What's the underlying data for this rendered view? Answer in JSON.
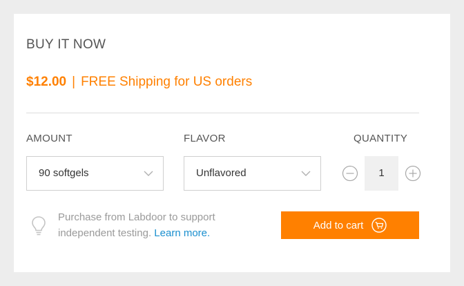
{
  "widget": {
    "title": "BUY IT NOW",
    "price": "$12.00",
    "separator": "|",
    "shipping": "FREE Shipping for US orders"
  },
  "options": {
    "amount": {
      "label": "AMOUNT",
      "value": "90 softgels"
    },
    "flavor": {
      "label": "FLAVOR",
      "value": "Unflavored"
    },
    "quantity": {
      "label": "QUANTITY",
      "value": "1"
    }
  },
  "promo": {
    "text": "Purchase from Labdoor to support independent testing.",
    "link": "Learn more."
  },
  "cart": {
    "label": "Add to cart"
  },
  "icons": {
    "chevron": "chevron-down-icon",
    "minus": "minus-circle-icon",
    "plus": "plus-circle-icon",
    "bulb": "lightbulb-icon",
    "cart": "cart-icon"
  },
  "colors": {
    "accent": "#ff8000",
    "link": "#1a8fcf",
    "background": "#ededed"
  }
}
